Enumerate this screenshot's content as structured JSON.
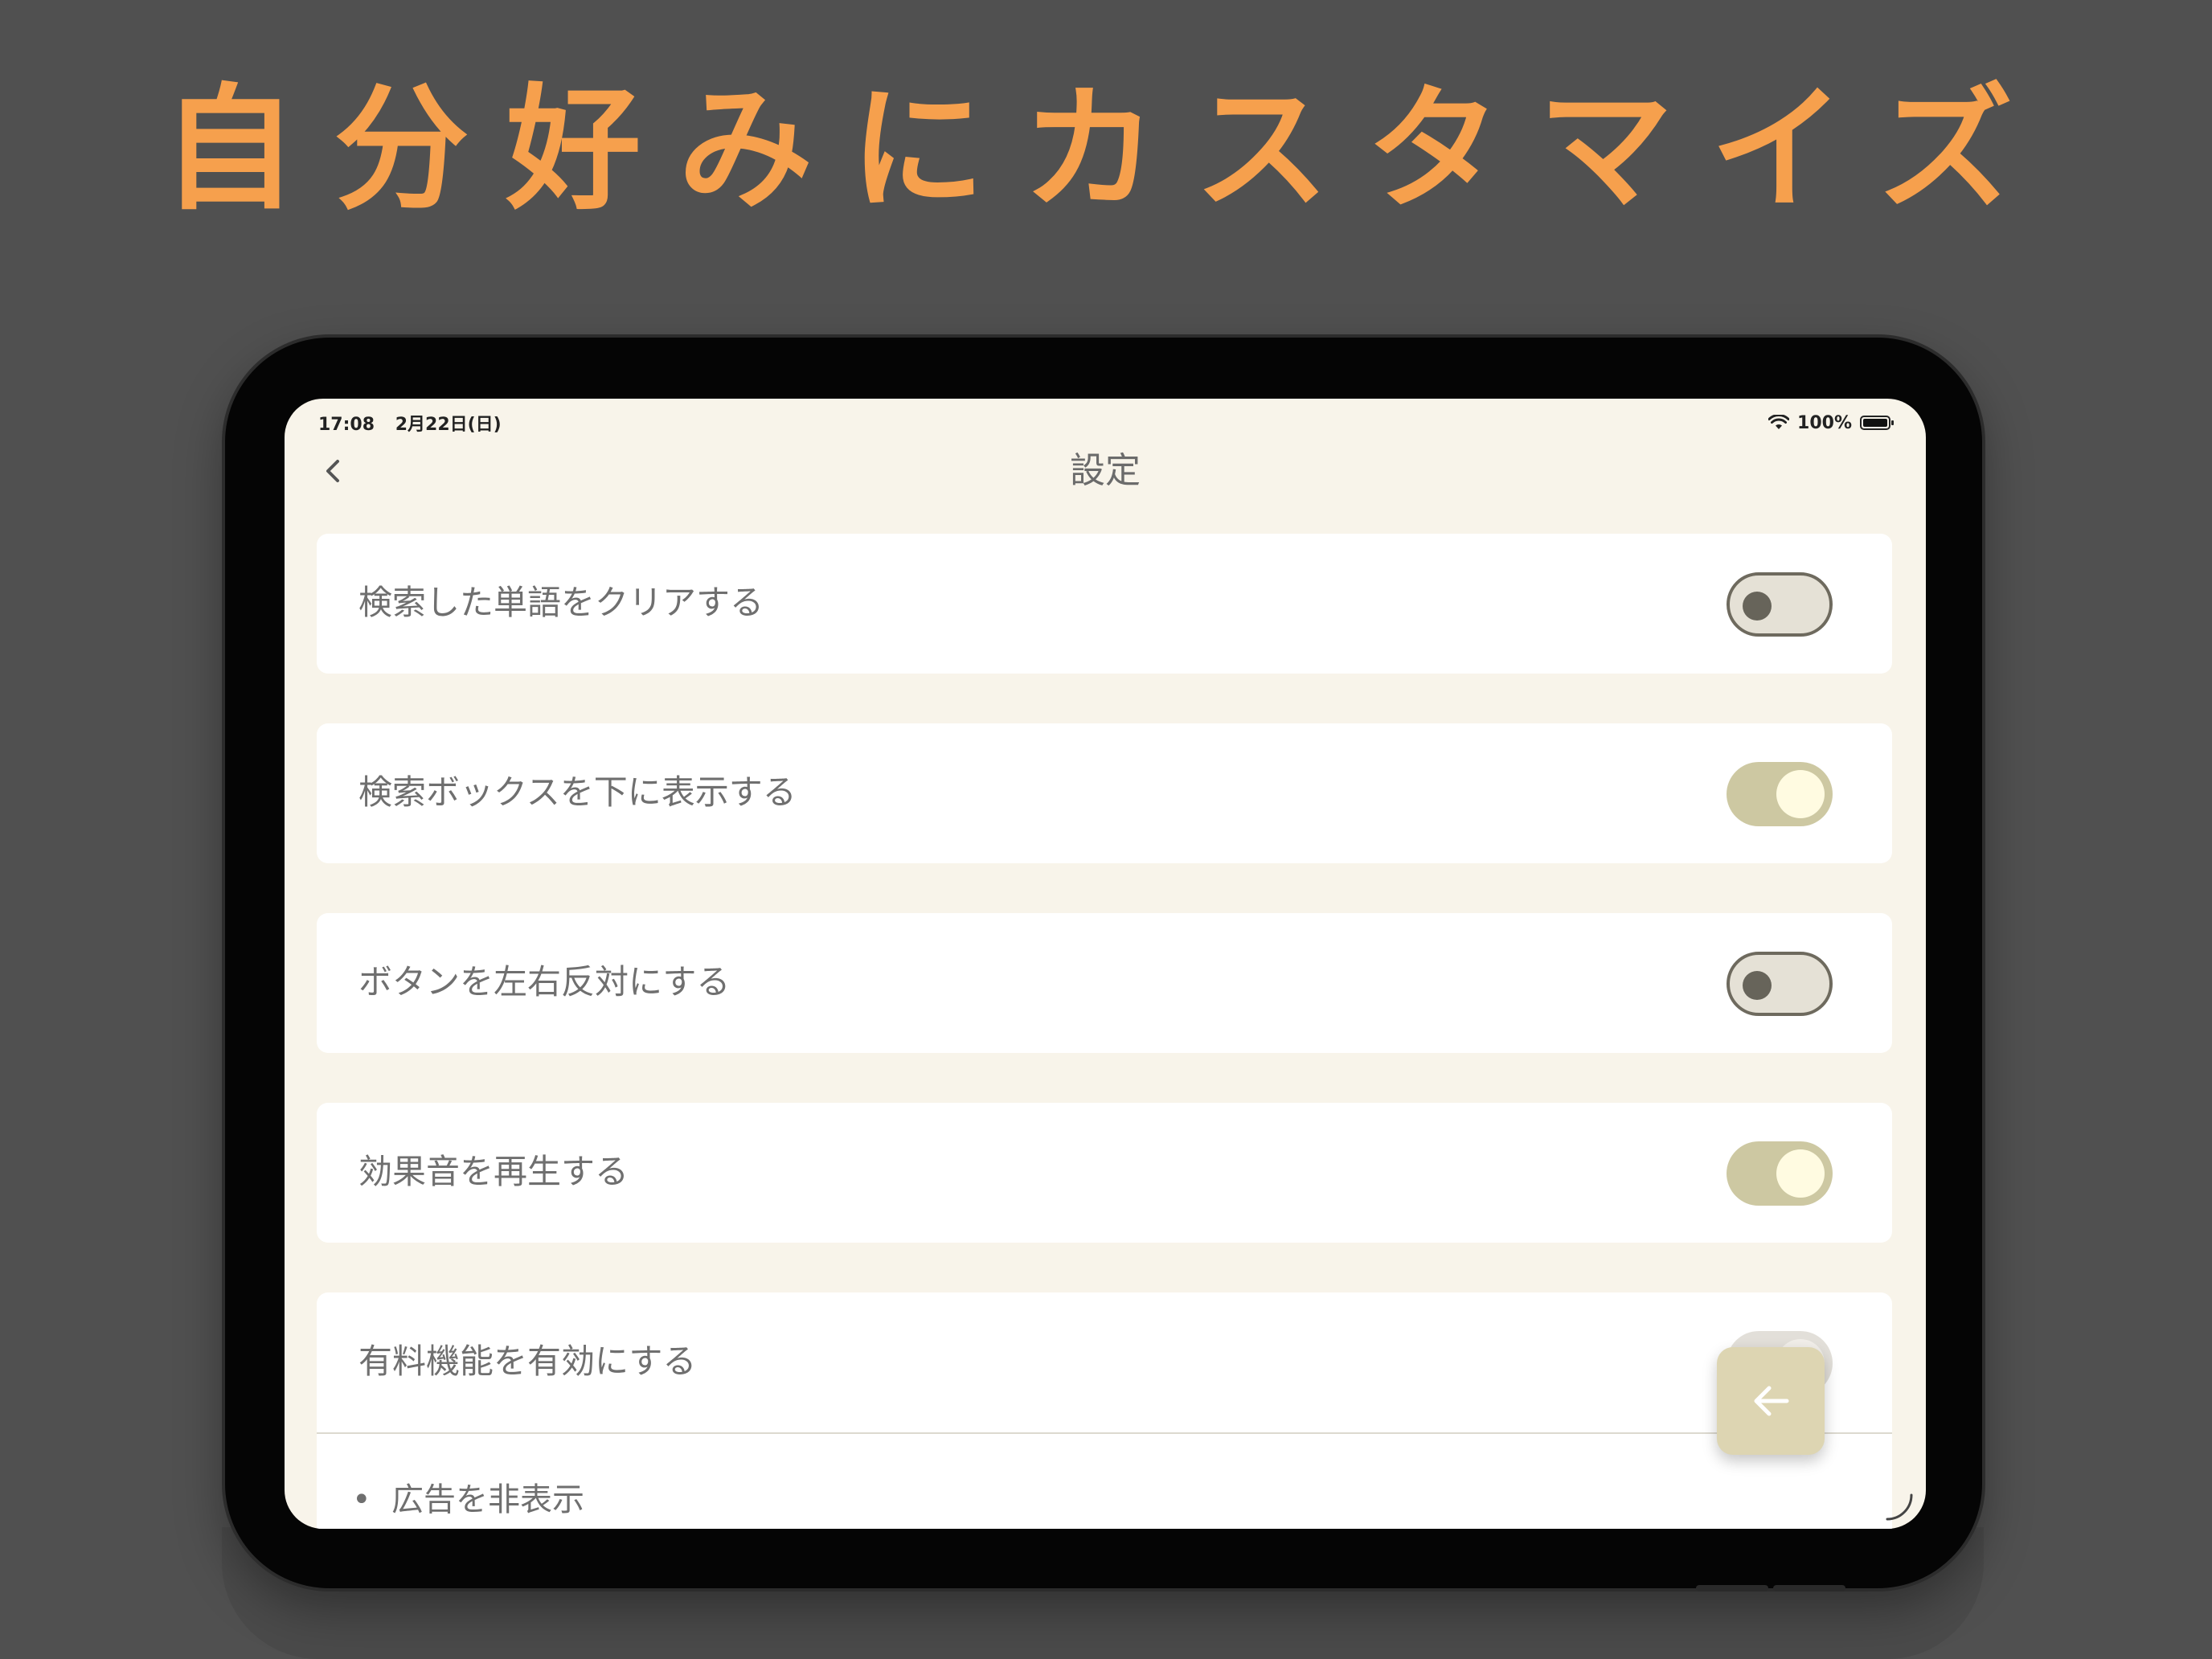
{
  "headline": "自分好みにカスタマイズ",
  "status_bar": {
    "time": "17:08",
    "date": "2月22日(日)",
    "battery": "100%"
  },
  "nav": {
    "title": "設定",
    "back_icon": "chevron-left-icon"
  },
  "settings": [
    {
      "label": "検索した単語をクリアする",
      "on": false
    },
    {
      "label": "検索ボックスを下に表示する",
      "on": true
    },
    {
      "label": "ボタンを左右反対にする",
      "on": false
    },
    {
      "label": "効果音を再生する",
      "on": true
    },
    {
      "label": "有料機能を有効にする",
      "on": false
    }
  ],
  "premium_features": [
    "広告を非表示"
  ],
  "fab": {
    "icon": "arrow-left-icon"
  },
  "colors": {
    "background": "#505050",
    "headline": "#f6a04d",
    "screen_bg": "#f8f4ea",
    "toggle_on": "#cdc8a2",
    "toggle_off": "#e5e1d6"
  }
}
